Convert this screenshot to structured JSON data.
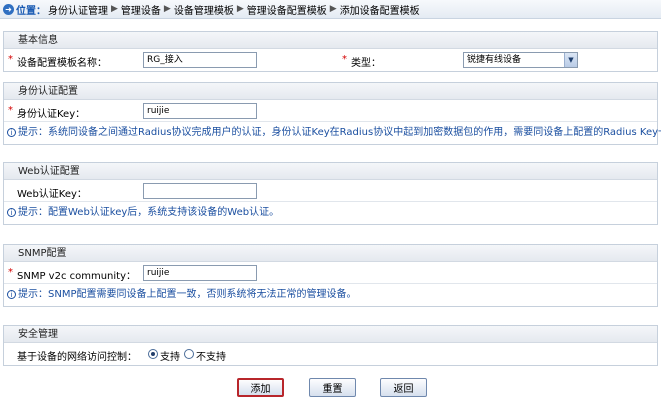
{
  "breadcrumb": {
    "location_label": "位置：",
    "items": [
      "身份认证管理",
      "管理设备",
      "设备管理模板",
      "管理设备配置模板",
      "添加设备配置模板"
    ]
  },
  "basic": {
    "title": "基本信息",
    "template_name_label": "设备配置模板名称：",
    "template_name_value": "RG_接入",
    "type_label": "类型：",
    "type_value": "锐捷有线设备"
  },
  "identity": {
    "title": "身份认证配置",
    "key_label": "身份认证Key：",
    "key_value": "ruijie",
    "hint": "提示：系统同设备之间通过Radius协议完成用户的认证，身份认证Key在Radius协议中起到加密数据包的作用，需要同设备上配置的Radius Key一致。"
  },
  "web": {
    "title": "Web认证配置",
    "key_label": "Web认证Key：",
    "key_value": "",
    "hint": "提示：配置Web认证key后，系统支持该设备的Web认证。"
  },
  "snmp": {
    "title": "SNMP配置",
    "community_label": "SNMP v2c community：",
    "community_value": "ruijie",
    "hint": "提示：SNMP配置需要同设备上配置一致，否则系统将无法正常的管理设备。"
  },
  "security": {
    "title": "安全管理",
    "access_label": "基于设备的网络访问控制：",
    "option_support": "支持",
    "option_not_support": "不支持",
    "selected": "支持"
  },
  "buttons": {
    "add": "添加",
    "reset": "重置",
    "back": "返回"
  },
  "colors": {
    "accent": "#1a5bb3",
    "required": "#d40000",
    "hint_text": "#1b4fa0",
    "primary_button_border": "#b8262b"
  },
  "icons": {
    "location": "location-icon",
    "breadcrumb_separator": "chevron-right-icon",
    "hint": "info-icon",
    "select_arrow": "chevron-down-icon"
  }
}
